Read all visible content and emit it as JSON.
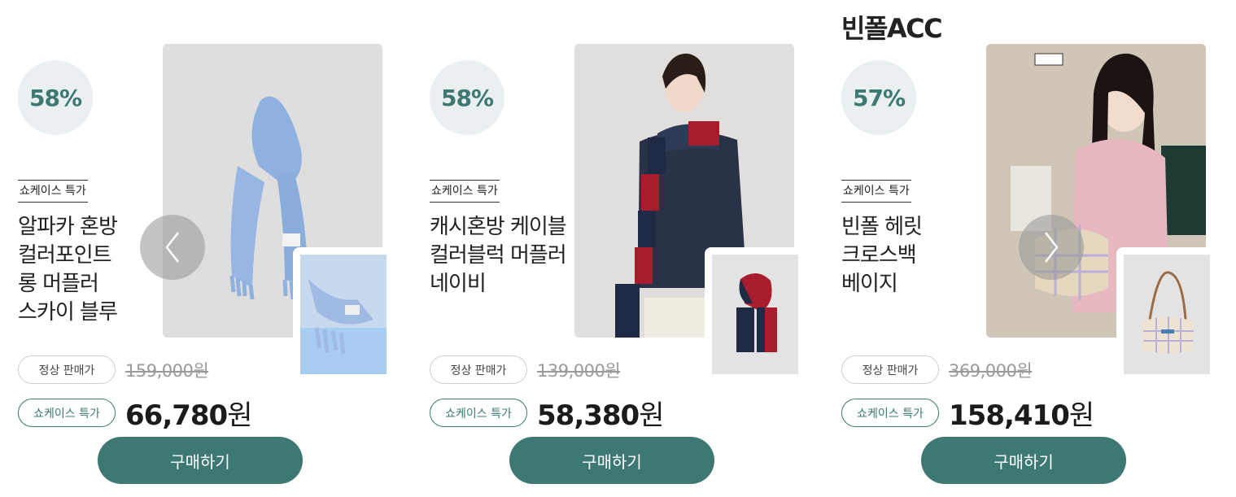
{
  "brand_header": "빈폴ACC",
  "prev_icon": "chevron-left-icon",
  "next_icon": "chevron-right-icon",
  "colors": {
    "accent": "#3d7872",
    "badge_bg": "#eaf0f1"
  },
  "products": [
    {
      "discount": "58%",
      "tag": "쇼케이스 특가",
      "name": "알파카 혼방\n컬러포인트\n롱 머플러\n스카이 블루",
      "normal_label": "정상 판매가",
      "normal_price": "159,000원",
      "sale_label": "쇼케이스 특가",
      "sale_price_num": "66,780",
      "sale_price_unit": "원",
      "buy_label": "구매하기"
    },
    {
      "discount": "58%",
      "tag": "쇼케이스 특가",
      "name": "캐시혼방 케이블\n컬러블럭 머플러\n네이비",
      "normal_label": "정상 판매가",
      "normal_price": "139,000원",
      "sale_label": "쇼케이스 특가",
      "sale_price_num": "58,380",
      "sale_price_unit": "원",
      "buy_label": "구매하기"
    },
    {
      "discount": "57%",
      "tag": "쇼케이스 특가",
      "name": "빈폴 헤릿\n크로스백\n베이지",
      "normal_label": "정상 판매가",
      "normal_price": "369,000원",
      "sale_label": "쇼케이스 특가",
      "sale_price_num": "158,410",
      "sale_price_unit": "원",
      "buy_label": "구매하기"
    }
  ]
}
